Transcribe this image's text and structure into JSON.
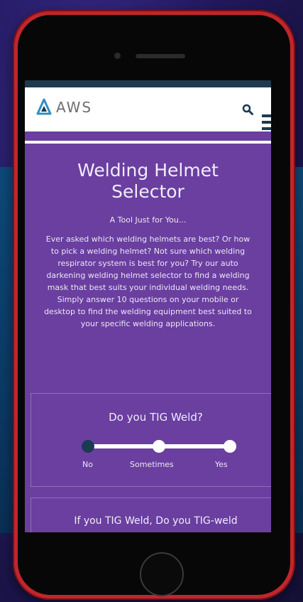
{
  "header": {
    "logo_text": "AWS"
  },
  "hero": {
    "title_line1": "Welding Helmet",
    "title_line2": "Selector",
    "subtitle": "A Tool Just for You...",
    "body": "Ever asked which welding helmets are best? Or how to pick a welding helmet? Not sure which welding respirator system is best for you? Try our auto darkening welding helmet selector to find a welding mask that best suits your individual welding needs. Simply answer 10 questions on your mobile or desktop to find the welding equipment best suited to your specific welding applications."
  },
  "question1": {
    "title": "Do you TIG Weld?",
    "options": [
      "No",
      "Sometimes",
      "Yes"
    ],
    "selected": "No"
  },
  "question2": {
    "title": "If you TIG Weld, Do you TIG-weld"
  },
  "colors": {
    "brand_purple": "#6a3fa0",
    "brand_navy": "#1a3b52",
    "phone_red": "#c0262c"
  }
}
